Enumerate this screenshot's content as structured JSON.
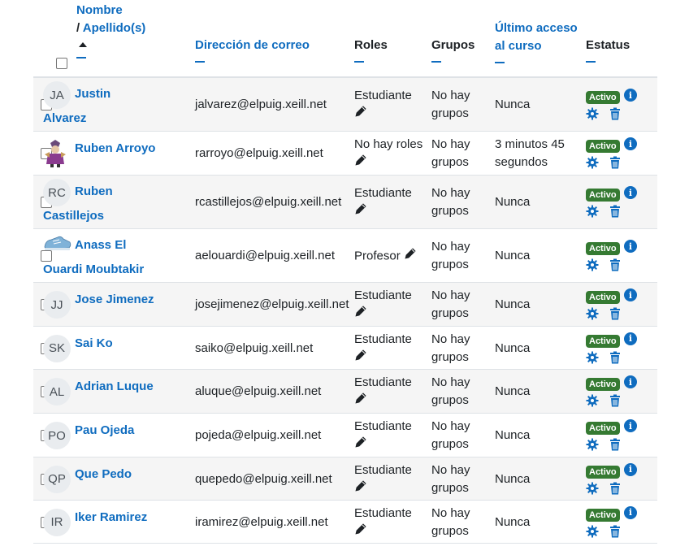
{
  "header": {
    "nombre": "Nombre",
    "apellidos_prefix": "/ ",
    "apellidos": "Apellido(s)",
    "email": "Dirección de correo",
    "roles": "Roles",
    "grupos": "Grupos",
    "acceso_line1": "Último acceso",
    "acceso_line2": "al curso",
    "estatus": "Estatus"
  },
  "status_badge": "Activo",
  "rows": [
    {
      "initials": "JA",
      "name_l1": "Justin",
      "name_l2": "Alvarez",
      "email": "jalvarez@elpuig.xeill.net",
      "role": "Estudiante",
      "groups_l1": "No hay",
      "groups_l2": "grupos",
      "access_l1": "Nunca",
      "access_l2": ""
    },
    {
      "initials": "",
      "name_l1": "Ruben Arroyo",
      "name_l2": "",
      "email": "rarroyo@elpuig.xeill.net",
      "role": "No hay roles",
      "groups_l1": "No hay",
      "groups_l2": "grupos",
      "access_l1": "3 minutos 45",
      "access_l2": "segundos"
    },
    {
      "initials": "RC",
      "name_l1": "Ruben",
      "name_l2": "Castillejos",
      "email": "rcastillejos@elpuig.xeill.net",
      "role": "Estudiante",
      "groups_l1": "No hay",
      "groups_l2": "grupos",
      "access_l1": "Nunca",
      "access_l2": ""
    },
    {
      "initials": "",
      "name_l1": "Anass El",
      "name_l2": "Ouardi Moubtakir",
      "email": "aelouardi@elpuig.xeill.net",
      "role": "Profesor",
      "groups_l1": "No hay",
      "groups_l2": "grupos",
      "access_l1": "Nunca",
      "access_l2": ""
    },
    {
      "initials": "JJ",
      "name_l1": "Jose Jimenez",
      "name_l2": "",
      "email": "josejimenez@elpuig.xeill.net",
      "role": "Estudiante",
      "groups_l1": "No hay",
      "groups_l2": "grupos",
      "access_l1": "Nunca",
      "access_l2": ""
    },
    {
      "initials": "SK",
      "name_l1": "Sai Ko",
      "name_l2": "",
      "email": "saiko@elpuig.xeill.net",
      "role": "Estudiante",
      "groups_l1": "No hay",
      "groups_l2": "grupos",
      "access_l1": "Nunca",
      "access_l2": ""
    },
    {
      "initials": "AL",
      "name_l1": "Adrian Luque",
      "name_l2": "",
      "email": "aluque@elpuig.xeill.net",
      "role": "Estudiante",
      "groups_l1": "No hay",
      "groups_l2": "grupos",
      "access_l1": "Nunca",
      "access_l2": ""
    },
    {
      "initials": "PO",
      "name_l1": "Pau Ojeda",
      "name_l2": "",
      "email": "pojeda@elpuig.xeill.net",
      "role": "Estudiante",
      "groups_l1": "No hay",
      "groups_l2": "grupos",
      "access_l1": "Nunca",
      "access_l2": ""
    },
    {
      "initials": "QP",
      "name_l1": "Que Pedo",
      "name_l2": "",
      "email": "quepedo@elpuig.xeill.net",
      "role": "Estudiante",
      "groups_l1": "No hay",
      "groups_l2": "grupos",
      "access_l1": "Nunca",
      "access_l2": ""
    },
    {
      "initials": "IR",
      "name_l1": "Iker Ramirez",
      "name_l2": "",
      "email": "iramirez@elpuig.xeill.net",
      "role": "Estudiante",
      "groups_l1": "No hay",
      "groups_l2": "grupos",
      "access_l1": "Nunca",
      "access_l2": ""
    }
  ],
  "icons": {
    "info": "info-icon",
    "edit": "pencil-icon",
    "settings": "gear-icon",
    "delete": "trash-icon",
    "sort": "sort-ascending-icon",
    "collapse": "minus-icon"
  },
  "colors": {
    "link": "#0f6cbf",
    "badge": "#357a32",
    "stripe": "#f5f5f5"
  }
}
